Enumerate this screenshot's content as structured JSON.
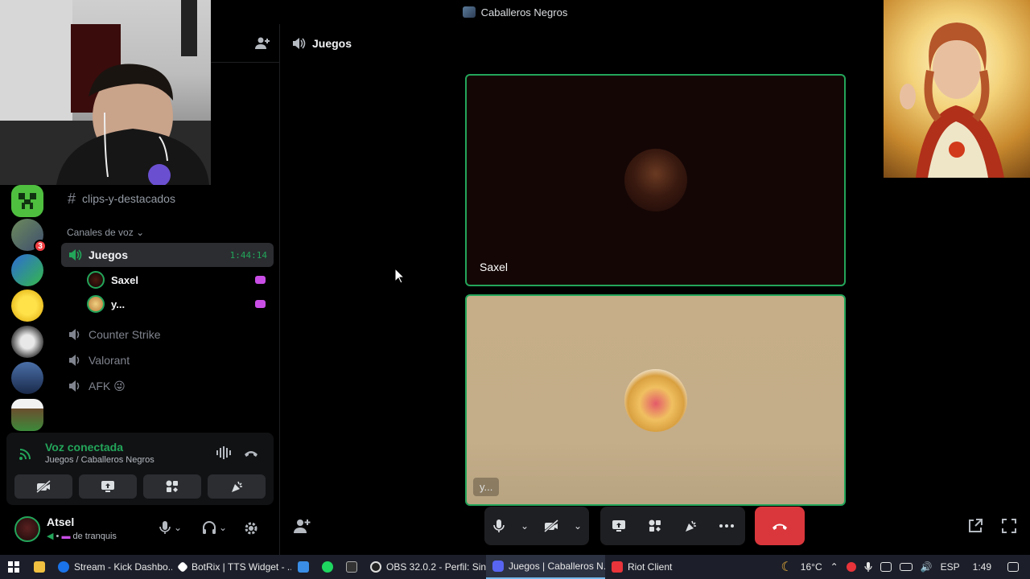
{
  "window": {
    "title": "Caballeros Negros"
  },
  "sidebar": {
    "text_channel": "clips-y-destacados",
    "voice_category": "Canales de voz",
    "voice_channels": [
      {
        "name": "Juegos",
        "time": "1:44:14",
        "active": true
      },
      {
        "name": "Counter Strike"
      },
      {
        "name": "Valorant"
      },
      {
        "name": "AFK 😜"
      }
    ],
    "voice_users": [
      {
        "name": "Saxel"
      },
      {
        "name": "y..."
      }
    ],
    "server_badge": "3"
  },
  "voice_panel": {
    "title": "Voz conectada",
    "subtitle": "Juegos / Caballeros Negros"
  },
  "user_panel": {
    "name": "Atsel",
    "status": "de tranquis"
  },
  "main": {
    "channel_title": "Juegos",
    "tiles": [
      {
        "name": "Saxel"
      },
      {
        "name": "y..."
      }
    ]
  },
  "taskbar": {
    "items": [
      {
        "label": "Stream - Kick Dashbo..."
      },
      {
        "label": "BotRix | TTS Widget - ..."
      },
      {
        "label": "OBS 32.0.2 - Perfil: Sin..."
      },
      {
        "label": "Juegos | Caballeros N..."
      },
      {
        "label": "Riot Client"
      }
    ],
    "temperature": "16°C",
    "language": "ESP",
    "clock": "1:49"
  },
  "colors": {
    "accent_green": "#23a55a",
    "hangup_red": "#da373c",
    "live_purple": "#c94ee6"
  }
}
